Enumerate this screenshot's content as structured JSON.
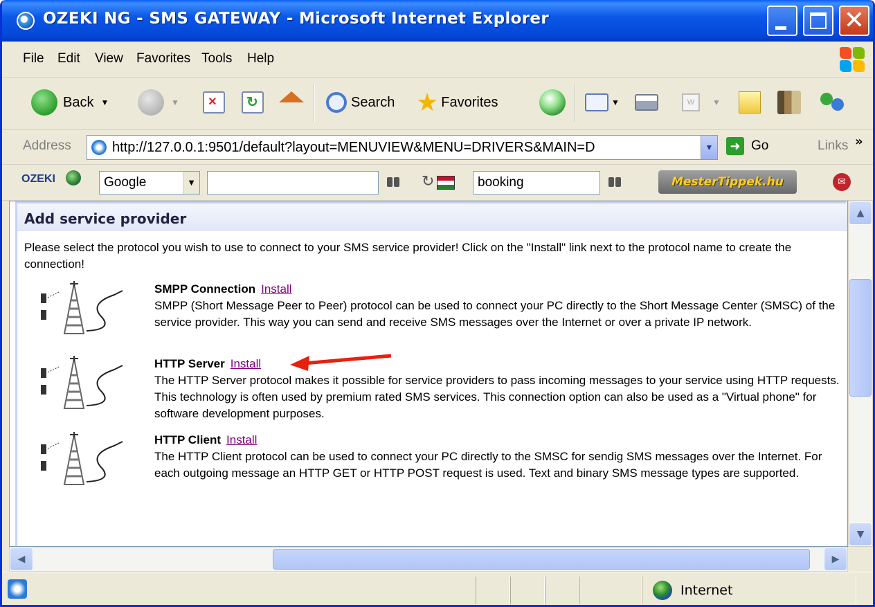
{
  "window": {
    "title": "OZEKI NG - SMS GATEWAY - Microsoft Internet Explorer"
  },
  "menubar": {
    "items": [
      "File",
      "Edit",
      "View",
      "Favorites",
      "Tools",
      "Help"
    ]
  },
  "toolbar": {
    "back_label": "Back",
    "search_label": "Search",
    "favorites_label": "Favorites"
  },
  "addressbar": {
    "label": "Address",
    "url": "http://127.0.0.1:9501/default?layout=MENUVIEW&MENU=DRIVERS&MAIN=D",
    "go_label": "Go",
    "links_label": "Links"
  },
  "googlebar": {
    "logo": "OZEKI",
    "engine": "Google",
    "search_value": "",
    "booking_value": "booking",
    "mester_logo": "MesterTippek.hu"
  },
  "content": {
    "heading": "Add service provider",
    "intro": "Please select the protocol you wish to use to connect to your SMS service provider! Click on the \"Install\" link next to the protocol name to create the connection!",
    "protocols": [
      {
        "name": "SMPP Connection",
        "install": "Install",
        "description": "SMPP (Short Message Peer to Peer) protocol can be used to connect your PC directly to the Short Message Center (SMSC) of the service provider. This way you can send and receive SMS messages over the Internet or over a private IP network."
      },
      {
        "name": "HTTP Server",
        "install": "Install",
        "description": "The HTTP Server protocol makes it possible for service providers to pass incoming messages to your service using HTTP requests. This technology is often used by premium rated SMS services. This connection option can also be used as a \"Virtual phone\" for software development purposes."
      },
      {
        "name": "HTTP Client",
        "install": "Install",
        "description": "The HTTP Client protocol can be used to connect your PC directly to the SMSC for sendig SMS messages over the Internet. For each outgoing message an HTTP GET or HTTP POST request is used. Text and binary SMS message types are supported."
      }
    ]
  },
  "statusbar": {
    "zone": "Internet"
  },
  "colors": {
    "titlebar": "#0a58e6",
    "link_visited": "#800080",
    "annotation_arrow": "#e8200e"
  }
}
